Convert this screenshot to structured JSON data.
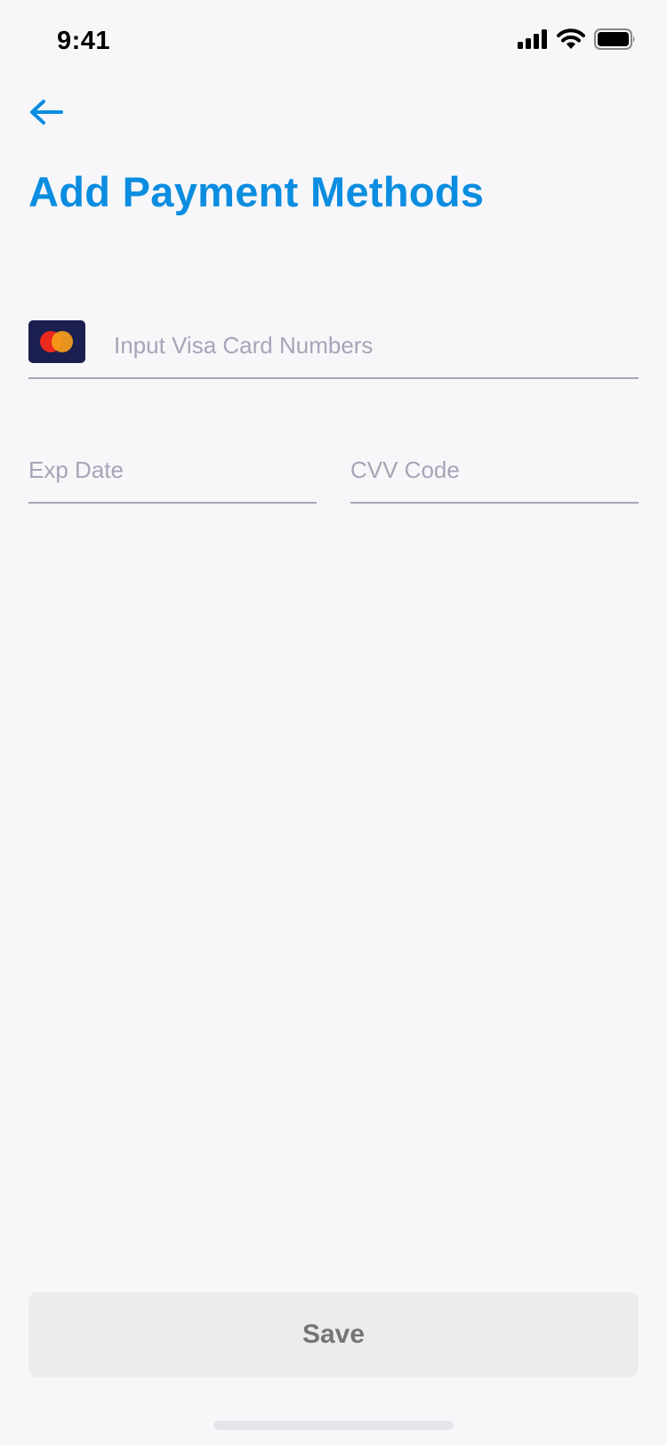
{
  "status_bar": {
    "time": "9:41",
    "icons": [
      "cellular-signal-icon",
      "wifi-icon",
      "battery-icon"
    ]
  },
  "header": {
    "back_icon": "arrow-left-icon",
    "title": "Add Payment Methods"
  },
  "form": {
    "card_number": {
      "placeholder": "Input Visa Card Numbers",
      "value": "",
      "card_brand_icon": "mastercard-icon"
    },
    "exp_date": {
      "placeholder": "Exp Date",
      "value": ""
    },
    "cvv": {
      "placeholder": "CVV Code",
      "value": ""
    }
  },
  "actions": {
    "save_label": "Save"
  },
  "colors": {
    "accent": "#0b8de0",
    "background": "#f7f7fa",
    "placeholder": "#a6a5b8",
    "underline": "#a7a4ba",
    "button_bg": "#ececef",
    "button_text": "#757575",
    "card_badge_bg": "#1b1f4f",
    "mastercard_red": "#eb2a1e",
    "mastercard_orange": "#f79e1b"
  }
}
